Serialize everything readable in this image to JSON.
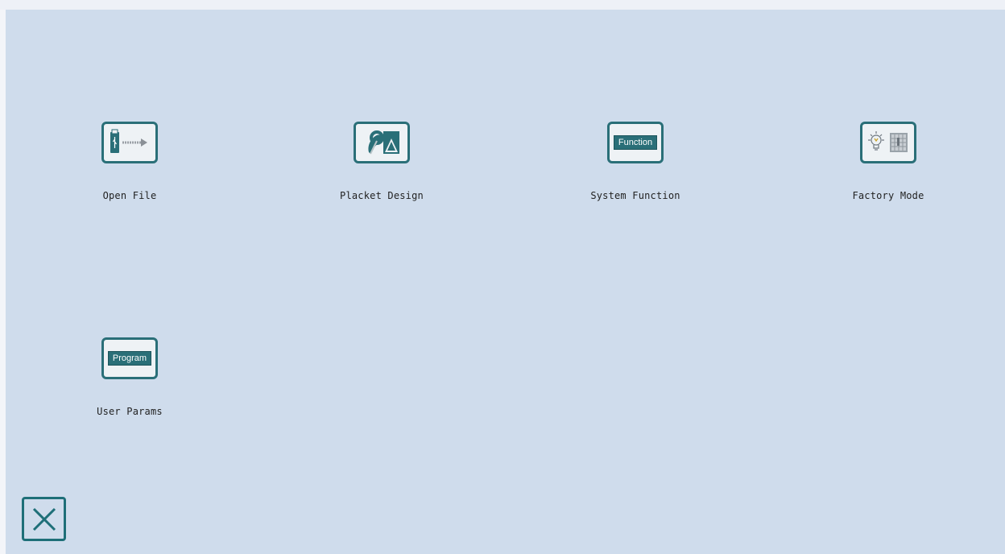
{
  "menu": {
    "items": [
      {
        "id": "open_file",
        "label": "Open File",
        "icon": "usb-transfer-icon"
      },
      {
        "id": "placket_design",
        "label": "Placket Design",
        "icon": "design-shapes-icon"
      },
      {
        "id": "system_function",
        "label": "System Function",
        "icon": "function-icon",
        "badge": "Function"
      },
      {
        "id": "factory_mode",
        "label": "Factory Mode",
        "icon": "factory-bulb-icon"
      },
      {
        "id": "user_params",
        "label": "User Params",
        "icon": "program-icon",
        "badge": "Program"
      }
    ]
  },
  "close": {
    "icon": "close-icon"
  },
  "colors": {
    "background": "#cfdcec",
    "accent": "#2a6f78"
  }
}
